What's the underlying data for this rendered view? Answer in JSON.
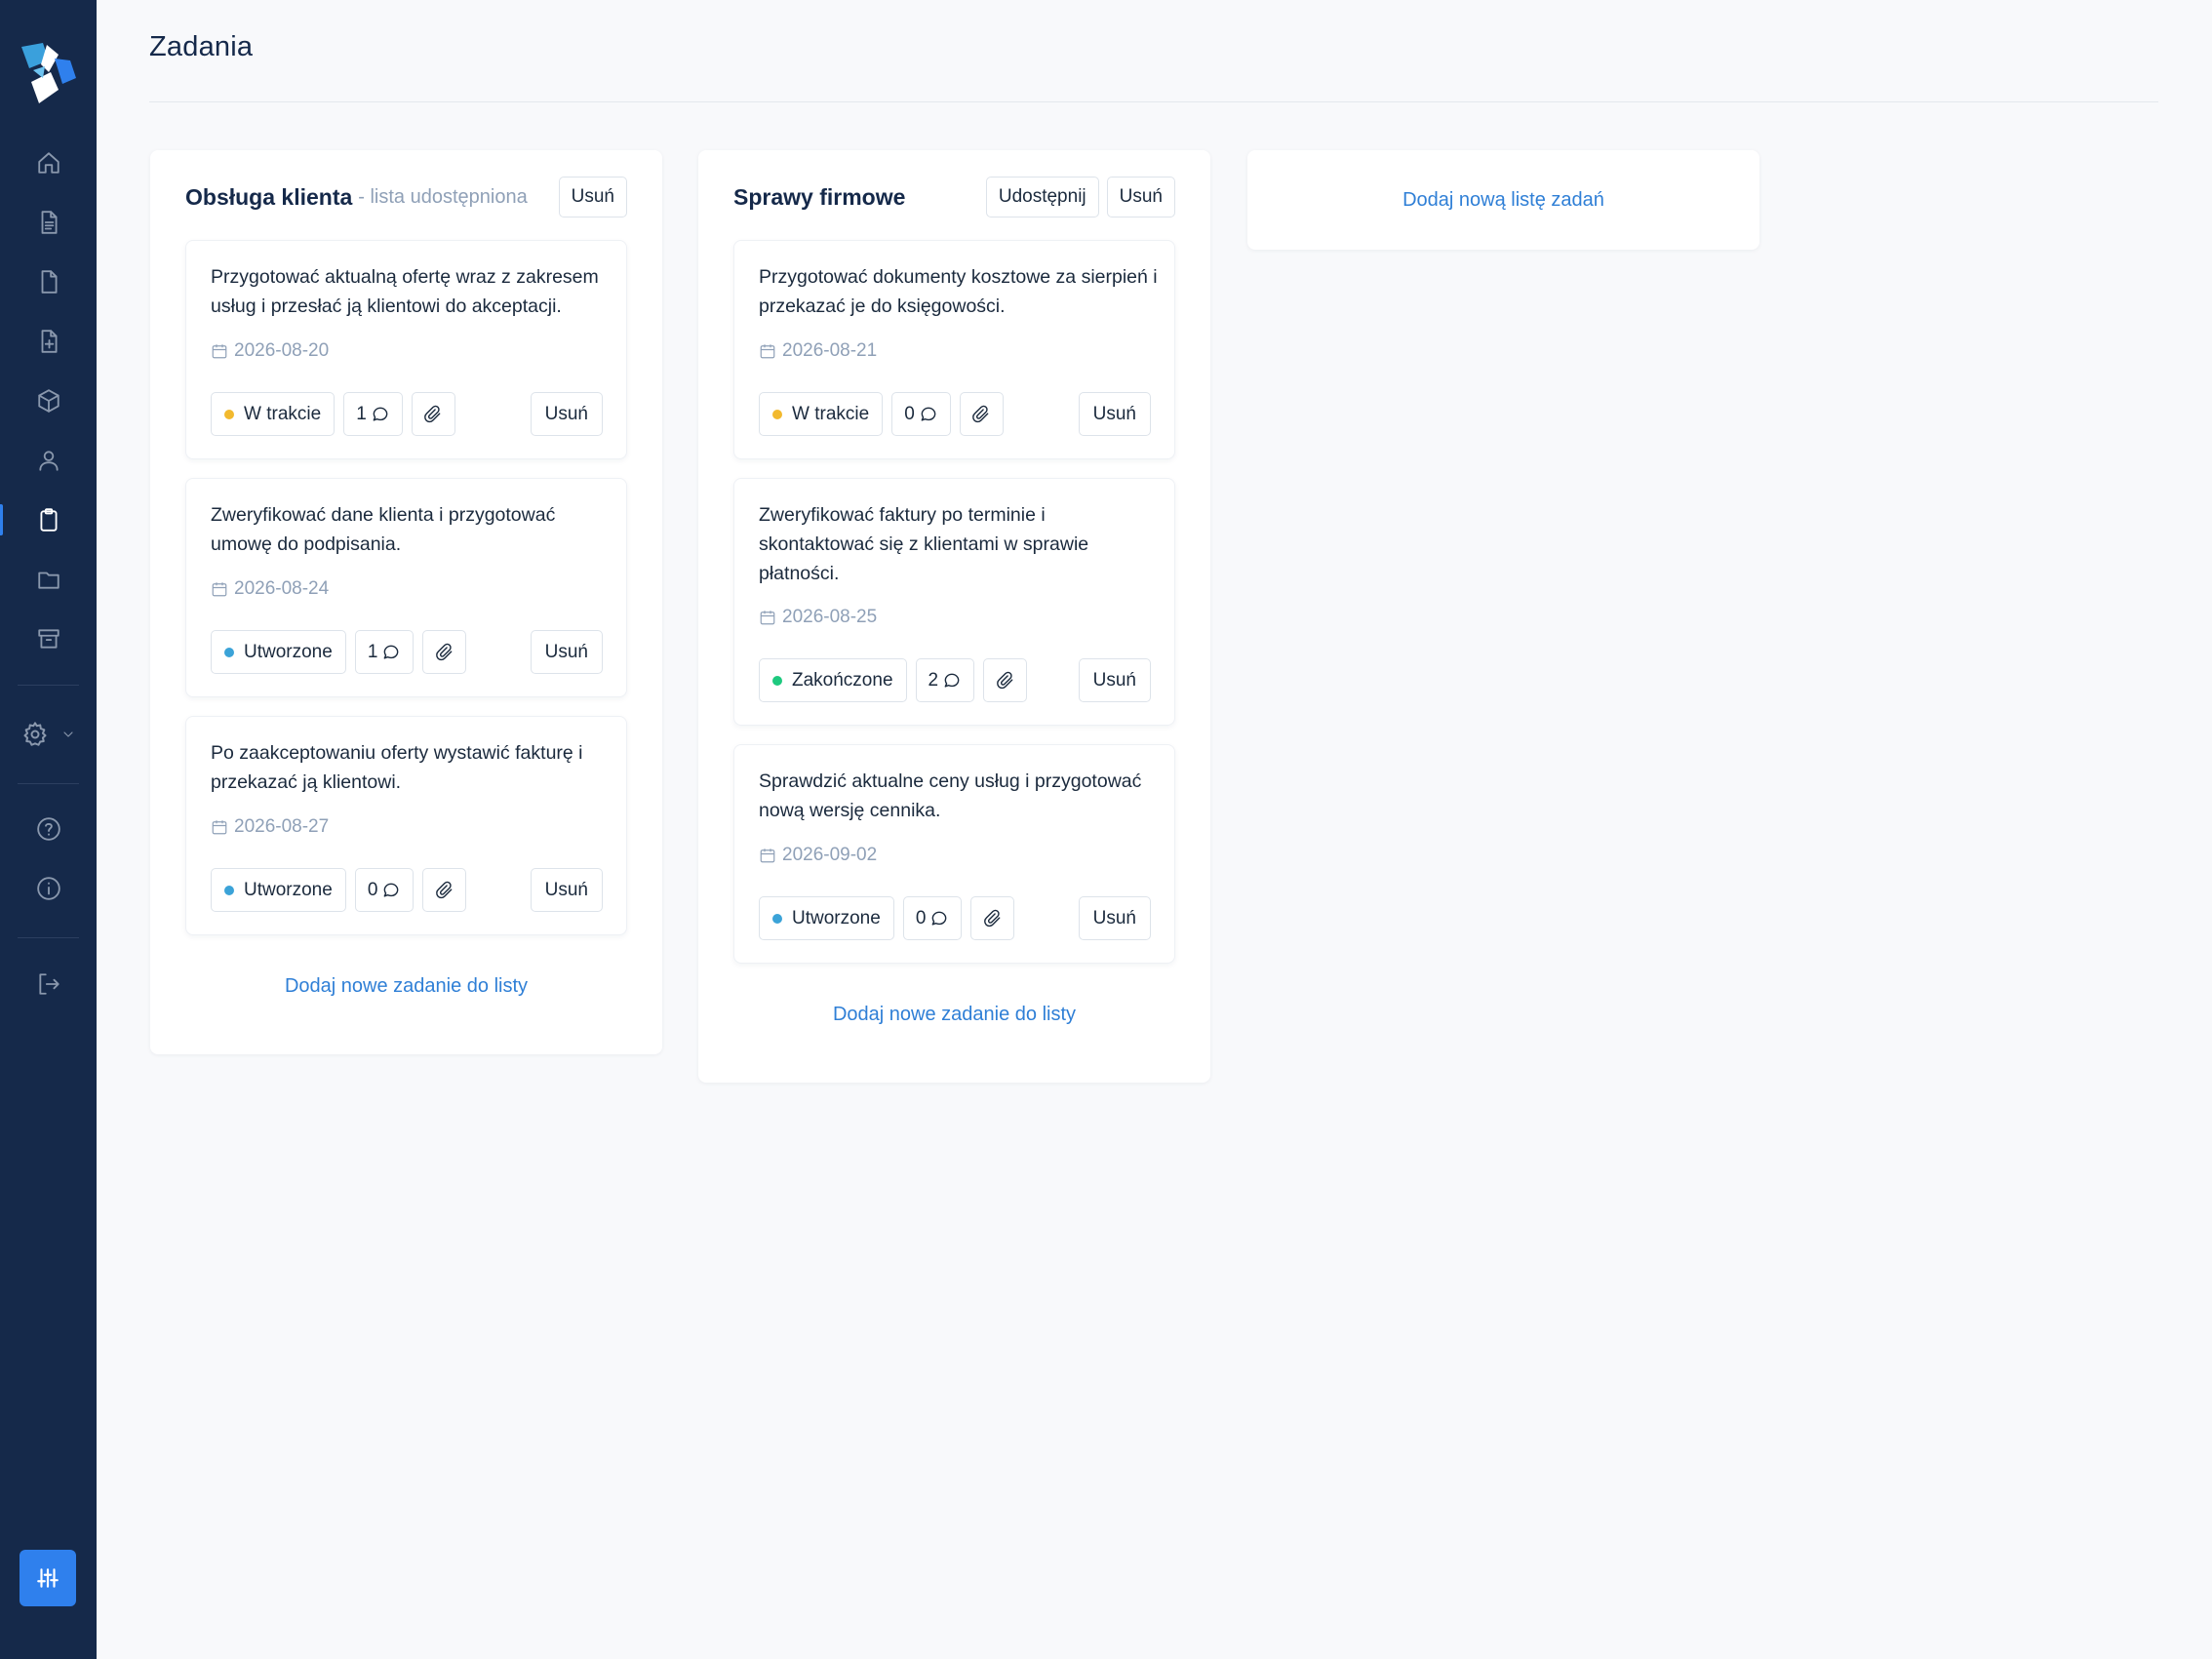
{
  "page": {
    "title": "Zadania"
  },
  "colors": {
    "sidebar": "#15294a",
    "accent": "#2f80ed",
    "link": "#2f7fd6",
    "status_in_progress": "#f2b92e",
    "status_created": "#3ba3d8",
    "status_done": "#1ec97f"
  },
  "sidebar": {
    "icons": [
      "home-icon",
      "document-icon",
      "file-icon",
      "file-plus-icon",
      "box-icon",
      "user-icon",
      "clipboard-icon",
      "folder-icon",
      "archive-icon",
      "gear-icon",
      "chevron-down-icon",
      "help-icon",
      "info-icon",
      "logout-icon",
      "sliders-icon"
    ],
    "active": "clipboard-icon"
  },
  "lists": [
    {
      "title": "Obsługa klienta",
      "subtitle": "- lista udostępniona",
      "delete_label": "Usuń",
      "add_task_label": "Dodaj nowe zadanie do listy",
      "tasks": [
        {
          "text": "Przygotować aktualną ofertę wraz z zakresem usług i przesłać ją klientowi do akceptacji.",
          "date": "2026-08-20",
          "status": "W trakcie",
          "comments": "1",
          "delete_label": "Usuń"
        },
        {
          "text": "Zweryfikować dane klienta i przygotować umowę do podpisania.",
          "date": "2026-08-24",
          "status": "Utworzone",
          "comments": "1",
          "delete_label": "Usuń"
        },
        {
          "text": "Po zaakceptowaniu oferty wystawić fakturę i przekazać ją klientowi.",
          "date": "2026-08-27",
          "status": "Utworzone",
          "comments": "0",
          "delete_label": "Usuń"
        }
      ]
    },
    {
      "title": "Sprawy firmowe",
      "share_label": "Udostępnij",
      "delete_label": "Usuń",
      "add_task_label": "Dodaj nowe zadanie do listy",
      "tasks": [
        {
          "text": "Przygotować dokumenty kosztowe za sierpień i przekazać je do księgowości.",
          "date": "2026-08-21",
          "status": "W trakcie",
          "comments": "0",
          "delete_label": "Usuń"
        },
        {
          "text": "Zweryfikować faktury po terminie i skontaktować się z klientami w sprawie płatności.",
          "date": "2026-08-25",
          "status": "Zakończone",
          "comments": "2",
          "delete_label": "Usuń"
        },
        {
          "text": "Sprawdzić aktualne ceny usług i przygotować nową wersję cennika.",
          "date": "2026-09-02",
          "status": "Utworzone",
          "comments": "0",
          "delete_label": "Usuń"
        }
      ]
    }
  ],
  "new_list_label": "Dodaj nową listę zadań"
}
